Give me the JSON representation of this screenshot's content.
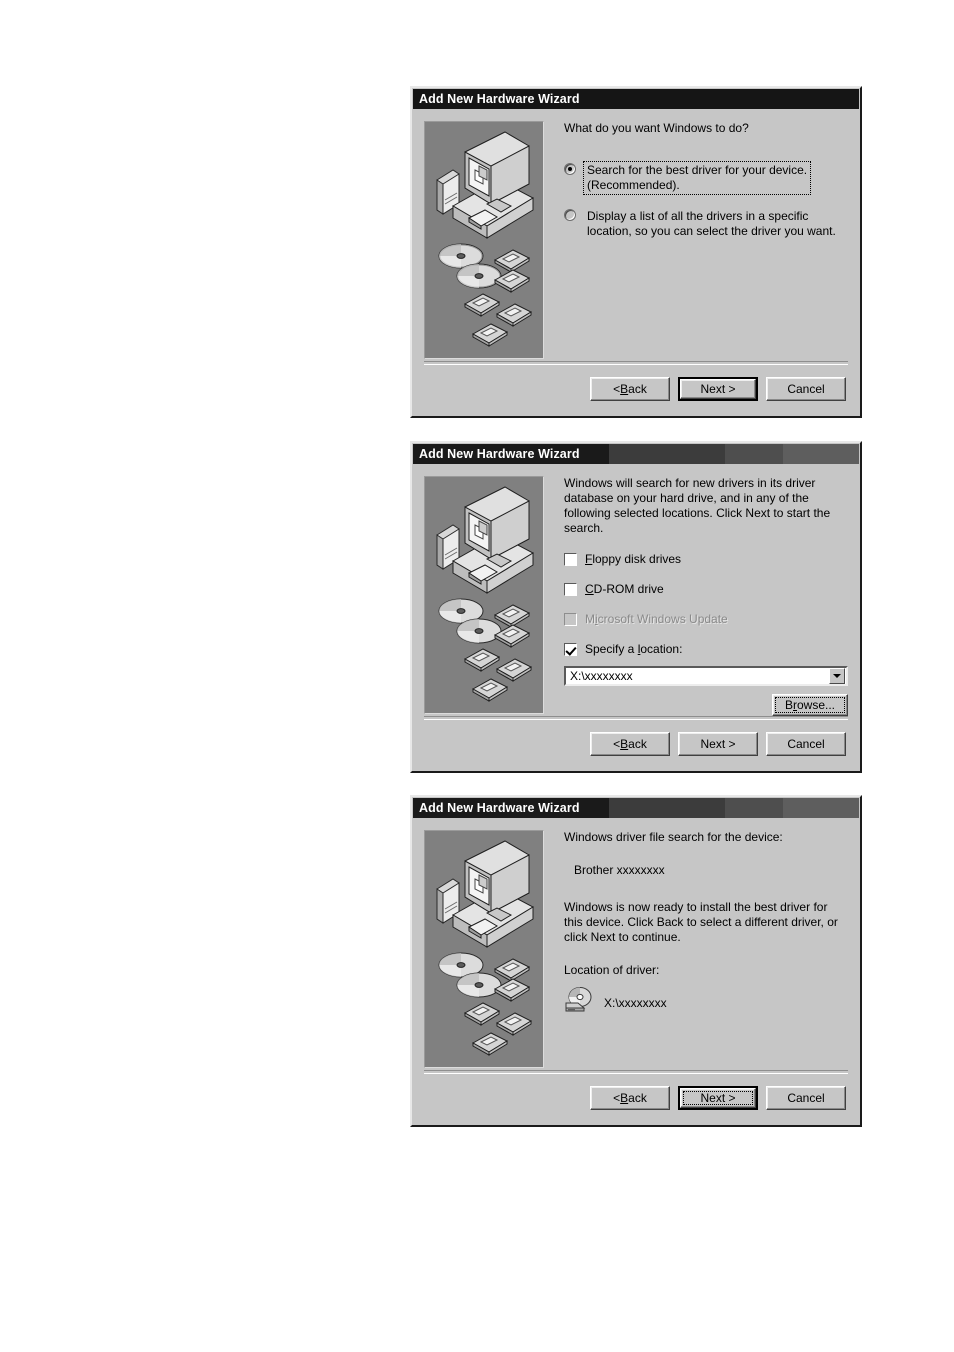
{
  "dialogs": [
    {
      "id": "dialog-1",
      "title": "Add New Hardware Wizard",
      "titlebar_style": "solid",
      "prompt": "What do you want Windows to do?",
      "options": [
        {
          "name": "search-best-driver",
          "line1": "Search for the best driver for your device.",
          "line2": "(Recommended).",
          "selected": true,
          "focused": true
        },
        {
          "name": "display-driver-list",
          "line1": "Display a list of all the drivers in a specific",
          "line2": "location, so you can select the driver you want.",
          "selected": false,
          "focused": false
        }
      ],
      "buttons": {
        "back": {
          "pre": "< ",
          "accel": "B",
          "post": "ack"
        },
        "next": {
          "pre": "",
          "accel": "",
          "post": "Next >",
          "default": true,
          "dotted": false
        },
        "cancel": {
          "pre": "",
          "accel": "",
          "post": "Cancel"
        }
      }
    },
    {
      "id": "dialog-2",
      "title": "Add New Hardware Wizard",
      "titlebar_style": "gradient",
      "paragraph": "Windows will search for new drivers in its driver database on your hard drive, and in any of the following selected locations. Click Next to start the search.",
      "checkboxes": [
        {
          "name": "floppy-disk-drives",
          "pre": "",
          "accel": "F",
          "post": "loppy disk drives",
          "checked": false,
          "disabled": false
        },
        {
          "name": "cd-rom-drive",
          "pre": "",
          "accel": "C",
          "post": "D-ROM drive",
          "checked": false,
          "disabled": false
        },
        {
          "name": "microsoft-windows-update",
          "pre": "M",
          "accel": "i",
          "post": "crosoft Windows Update",
          "checked": false,
          "disabled": true
        },
        {
          "name": "specify-a-location",
          "pre": "Specify a ",
          "accel": "l",
          "post": "ocation:",
          "checked": true,
          "disabled": false
        }
      ],
      "location_combo": {
        "value": "X:\\xxxxxxxx",
        "placeholder": "X:\\xxxxxxxx"
      },
      "browse_button": {
        "pre": "B",
        "accel": "r",
        "post": "owse..."
      },
      "buttons": {
        "back": {
          "pre": "< ",
          "accel": "B",
          "post": "ack"
        },
        "next": {
          "pre": "",
          "accel": "",
          "post": "Next >",
          "default": false,
          "dotted": false
        },
        "cancel": {
          "pre": "",
          "accel": "",
          "post": "Cancel"
        }
      }
    },
    {
      "id": "dialog-3",
      "title": "Add New Hardware Wizard",
      "titlebar_style": "gradient",
      "heading": "Windows driver file search for the device:",
      "device_name": "Brother  xxxxxxxx",
      "paragraph": "Windows is now ready to install the best driver for this device. Click Back to select a different driver, or click Next to continue.",
      "location_label": "Location of driver:",
      "location_value": "X:\\xxxxxxxx",
      "location_icon": "cdrom-drive-icon",
      "buttons": {
        "back": {
          "pre": "< ",
          "accel": "B",
          "post": "ack"
        },
        "next": {
          "pre": "",
          "accel": "",
          "post": "Next >",
          "default": true,
          "dotted": true
        },
        "cancel": {
          "pre": "",
          "accel": "",
          "post": "Cancel"
        }
      }
    }
  ],
  "illustration": {
    "name": "hardware-wizard-illustration",
    "description": "computer with CDs and floppy disks",
    "background": "#808080"
  },
  "colors": {
    "dialog_face": "#c6c6c6",
    "titlebar_dark": "#151515",
    "illustration_bg": "#808080",
    "field_bg": "#ffffff",
    "disabled_text": "#8a8a8a"
  }
}
